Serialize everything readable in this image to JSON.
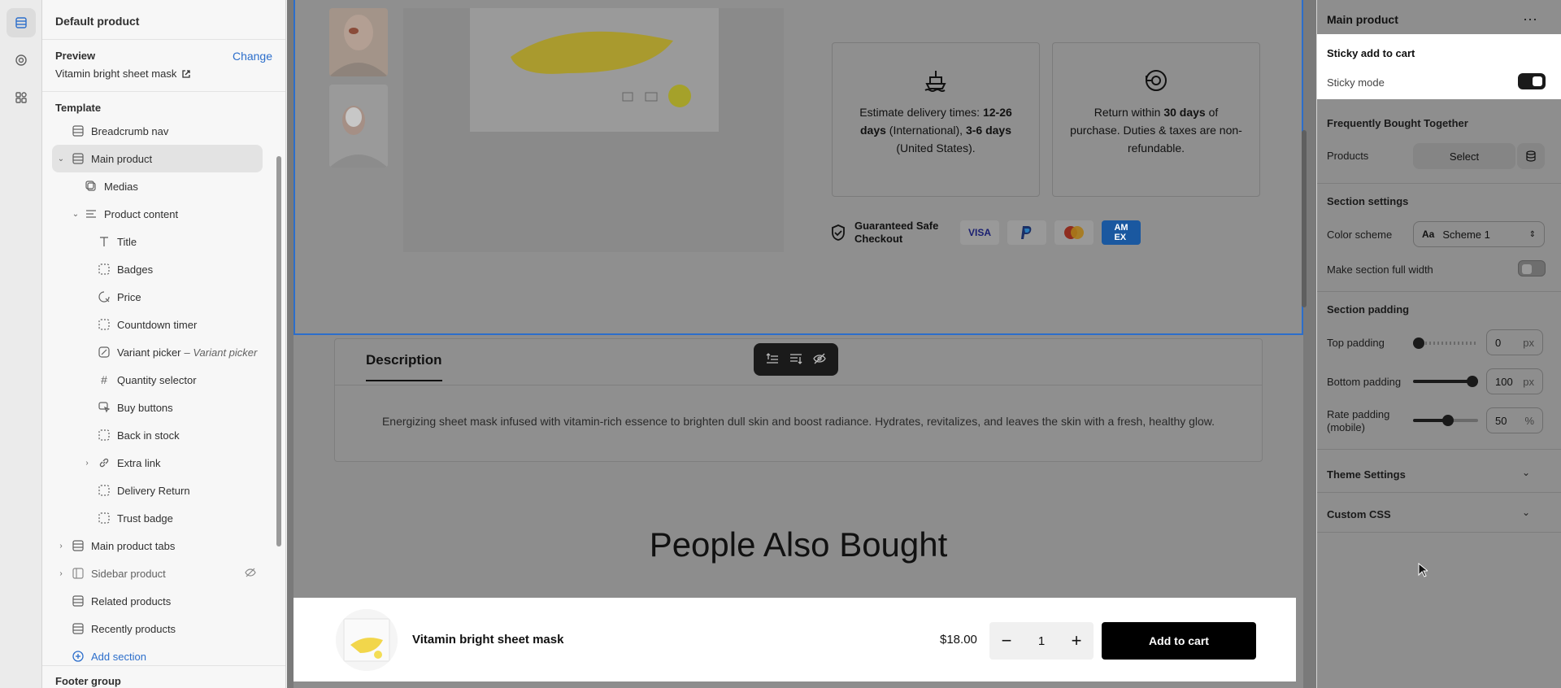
{
  "app": {
    "product_title": "Default product"
  },
  "left_panel": {
    "preview_label": "Preview",
    "change_label": "Change",
    "preview_value": "Vitamin bright sheet mask",
    "template_label": "Template",
    "items": [
      {
        "label": "Breadcrumb nav"
      },
      {
        "label": "Main product"
      },
      {
        "label": "Medias"
      },
      {
        "label": "Product content"
      },
      {
        "label": "Title"
      },
      {
        "label": "Badges"
      },
      {
        "label": "Price"
      },
      {
        "label": "Countdown timer"
      },
      {
        "label": "Variant picker",
        "sub": "– Variant picker"
      },
      {
        "label": "Quantity selector"
      },
      {
        "label": "Buy buttons"
      },
      {
        "label": "Back in stock"
      },
      {
        "label": "Extra link"
      },
      {
        "label": "Delivery Return"
      },
      {
        "label": "Trust badge"
      },
      {
        "label": "Main product tabs"
      },
      {
        "label": "Sidebar product"
      },
      {
        "label": "Related products"
      },
      {
        "label": "Recently products"
      }
    ],
    "add_section": "Add section",
    "footer_group": "Footer group"
  },
  "canvas": {
    "delivery": {
      "pre": "Estimate delivery times: ",
      "b1": "12-26 days",
      "mid": " (International), ",
      "b2": "3-6 days",
      "post": " (United States)."
    },
    "returns": {
      "pre": "Return within ",
      "b1": "30 days",
      "post": " of purchase. Duties & taxes are non-refundable."
    },
    "safe_checkout": "Guaranteed Safe Checkout",
    "payment_icons": [
      "VISA",
      "PayPal",
      "Mastercard",
      "AMEX"
    ],
    "description_tab": "Description",
    "description_text": "Energizing sheet mask infused with vitamin-rich essence to brighten dull skin and boost radiance. Hydrates, revitalizes, and leaves the skin with a fresh, healthy glow.",
    "people_also_bought": "People Also Bought"
  },
  "sticky_bar": {
    "product_name": "Vitamin bright sheet mask",
    "price": "$18.00",
    "quantity": "1",
    "add_to_cart": "Add to cart"
  },
  "right_panel": {
    "title": "Main product",
    "sticky_title": "Sticky add to cart",
    "sticky_mode_label": "Sticky mode",
    "sticky_mode_on": true,
    "fbt_title": "Frequently Bought Together",
    "products_label": "Products",
    "select_label": "Select",
    "section_settings": "Section settings",
    "color_scheme_label": "Color scheme",
    "color_scheme_value": "Scheme 1",
    "full_width_label": "Make section full width",
    "full_width_on": false,
    "section_padding": "Section padding",
    "top_padding_label": "Top padding",
    "top_padding_value": "0",
    "bottom_padding_label": "Bottom padding",
    "bottom_padding_value": "100",
    "rate_padding_label": "Rate padding (mobile)",
    "rate_padding_value": "50",
    "unit_px": "px",
    "unit_pct": "%",
    "theme_settings": "Theme Settings",
    "custom_css": "Custom CSS"
  },
  "colors": {
    "accent": "#2c6ecb",
    "overlay": "#8e8e8e"
  }
}
